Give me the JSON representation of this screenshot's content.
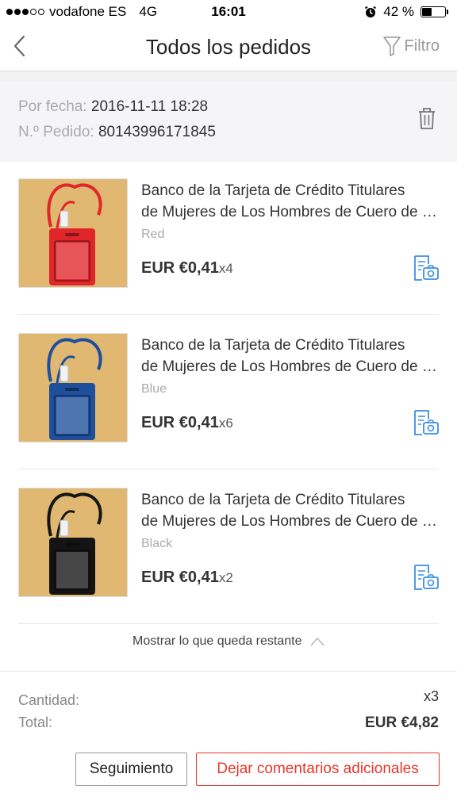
{
  "status_bar": {
    "carrier": "vodafone ES",
    "network": "4G",
    "time": "16:01",
    "battery": "42 %",
    "battery_level": 0.42
  },
  "nav": {
    "title": "Todos los pedidos",
    "filter_label": "Filtro"
  },
  "order": {
    "date_label": "Por fecha:",
    "date_value": "2016-11-11 18:28",
    "number_label": "N.º Pedido:",
    "number_value": "80143996171845"
  },
  "items": [
    {
      "title_line1": "Banco de la Tarjeta de Crédito Titulares",
      "title_line2": "de Mujeres de Los Hombres de Cuero de Cuero",
      "variant": "Red",
      "price": "EUR €0,41",
      "qty": "x4",
      "color": "#e0262b"
    },
    {
      "title_line1": "Banco de la Tarjeta de Crédito Titulares",
      "title_line2": "de Mujeres de Los Hombres de Cuero de Cuero",
      "variant": "Blue",
      "price": "EUR €0,41",
      "qty": "x6",
      "color": "#1e4f9c"
    },
    {
      "title_line1": "Banco de la Tarjeta de Crédito Titulares",
      "title_line2": "de Mujeres de Los Hombres de Cuero de Cuero",
      "variant": "Black",
      "price": "EUR €0,41",
      "qty": "x2",
      "color": "#141414"
    }
  ],
  "show_more": "Mostrar lo que queda restante",
  "summary": {
    "quantity_label": "Cantidad:",
    "quantity_value": "x3",
    "total_label": "Total:",
    "total_value": "EUR €4,82"
  },
  "buttons": {
    "tracking": "Seguimiento",
    "feedback": "Dejar comentarios adicionales"
  },
  "colors": {
    "accent": "#e8362b",
    "icon_blue": "#3a8ee6",
    "header_bg": "#f5f5f7"
  }
}
